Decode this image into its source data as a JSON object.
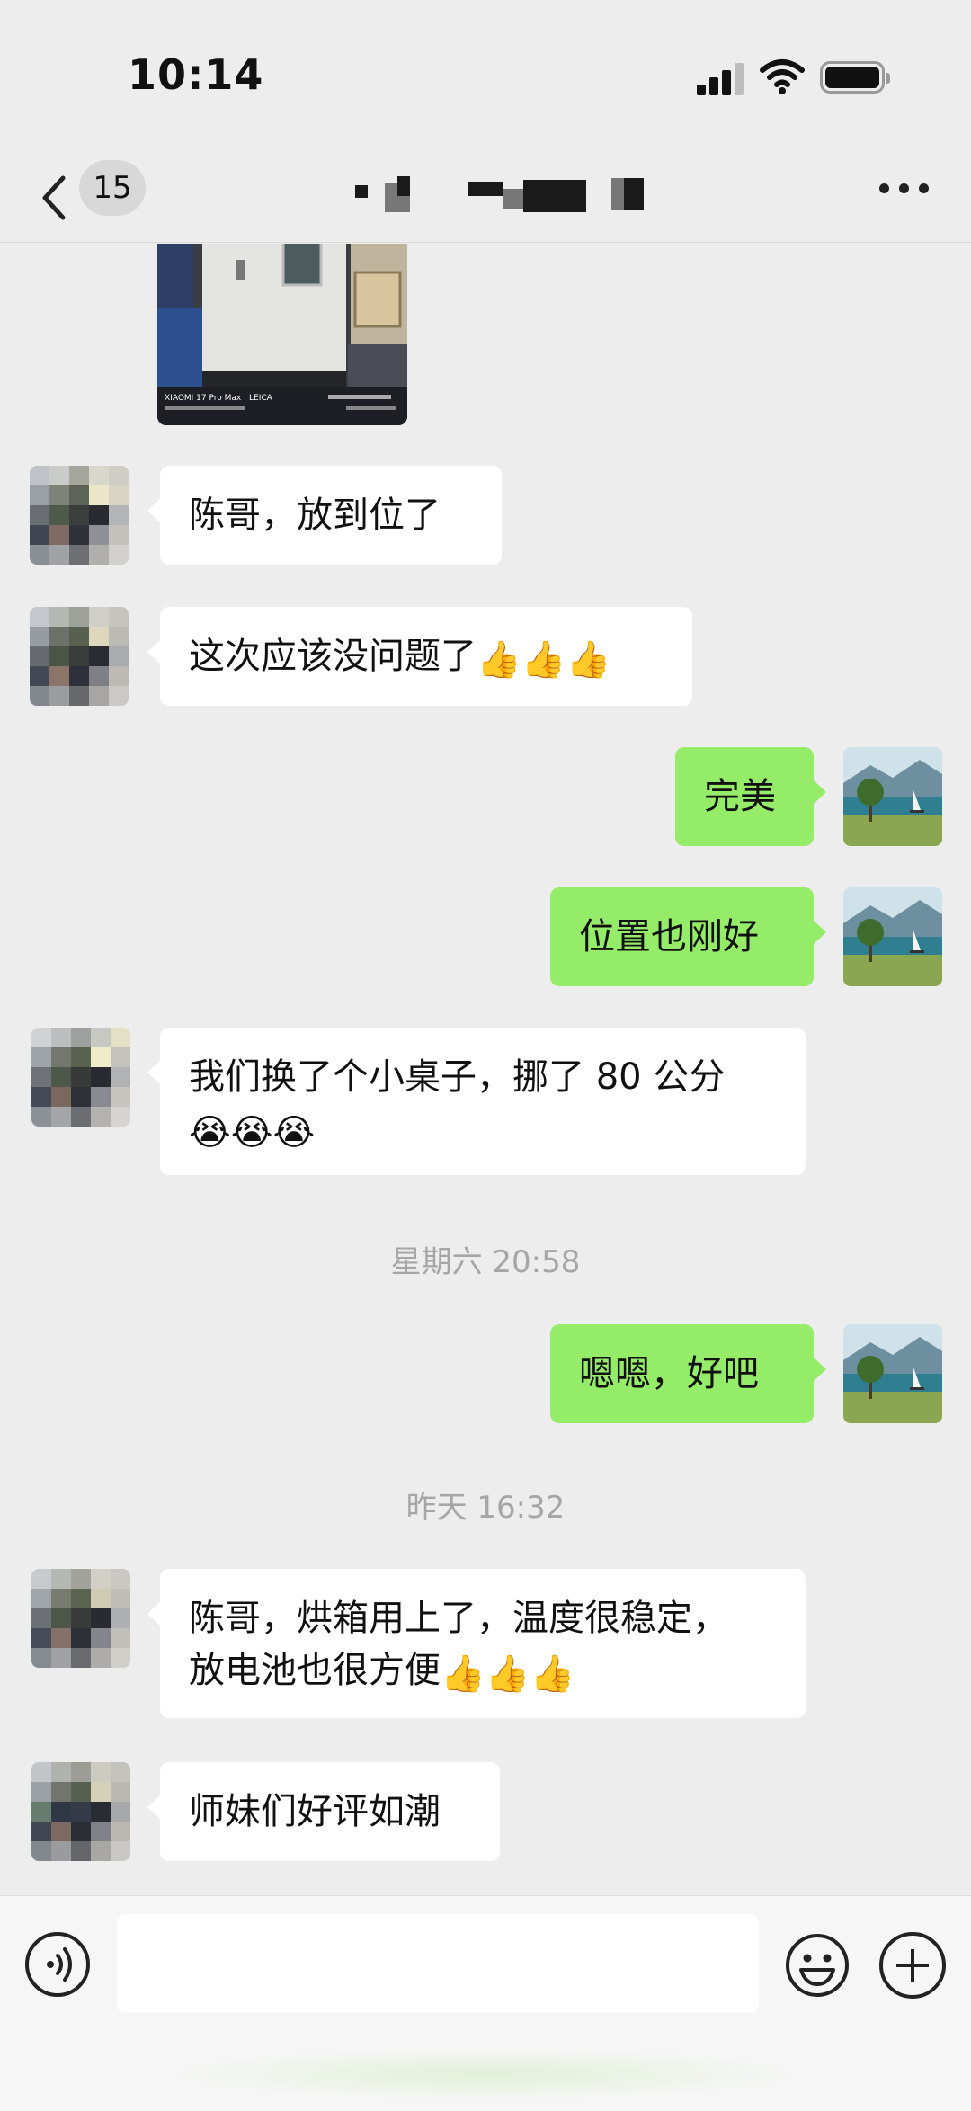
{
  "status_bar": {
    "time": "10:14"
  },
  "nav": {
    "back_icon": "chevron-left-icon",
    "unread_count": "15",
    "more_icon": "more-dots-icon"
  },
  "messages": [
    {
      "side": "in",
      "type": "image",
      "caption": "XIAOMI 17 Pro Max | LEICA"
    },
    {
      "side": "in",
      "type": "text",
      "text": "陈哥，放到位了"
    },
    {
      "side": "in",
      "type": "text",
      "text": "这次应该没问题了",
      "emoji": "👍👍👍"
    },
    {
      "side": "out",
      "type": "text",
      "text": "完美"
    },
    {
      "side": "out",
      "type": "text",
      "text": "位置也刚好"
    },
    {
      "side": "in",
      "type": "text",
      "text": "我们换了个小桌子，挪了 80 公分",
      "emoji": "😭😭😭"
    },
    {
      "type": "timestamp",
      "text": "星期六 20:58"
    },
    {
      "side": "out",
      "type": "text",
      "text": "嗯嗯，好吧"
    },
    {
      "type": "timestamp",
      "text": "昨天 16:32"
    },
    {
      "side": "in",
      "type": "text",
      "line1": "陈哥，烘箱用上了，温度很稳定，",
      "line2": "放电池也很方便",
      "emoji": "👍👍👍"
    },
    {
      "side": "in",
      "type": "text",
      "text": "师妹们好评如潮"
    }
  ],
  "input_bar": {
    "voice_icon": "voice-icon",
    "input_value": "",
    "emoji_icon": "smiley-icon",
    "plus_icon": "plus-icon"
  },
  "colors": {
    "bubble_out": "#95ec69",
    "bubble_in": "#ffffff",
    "background": "#ededed"
  }
}
